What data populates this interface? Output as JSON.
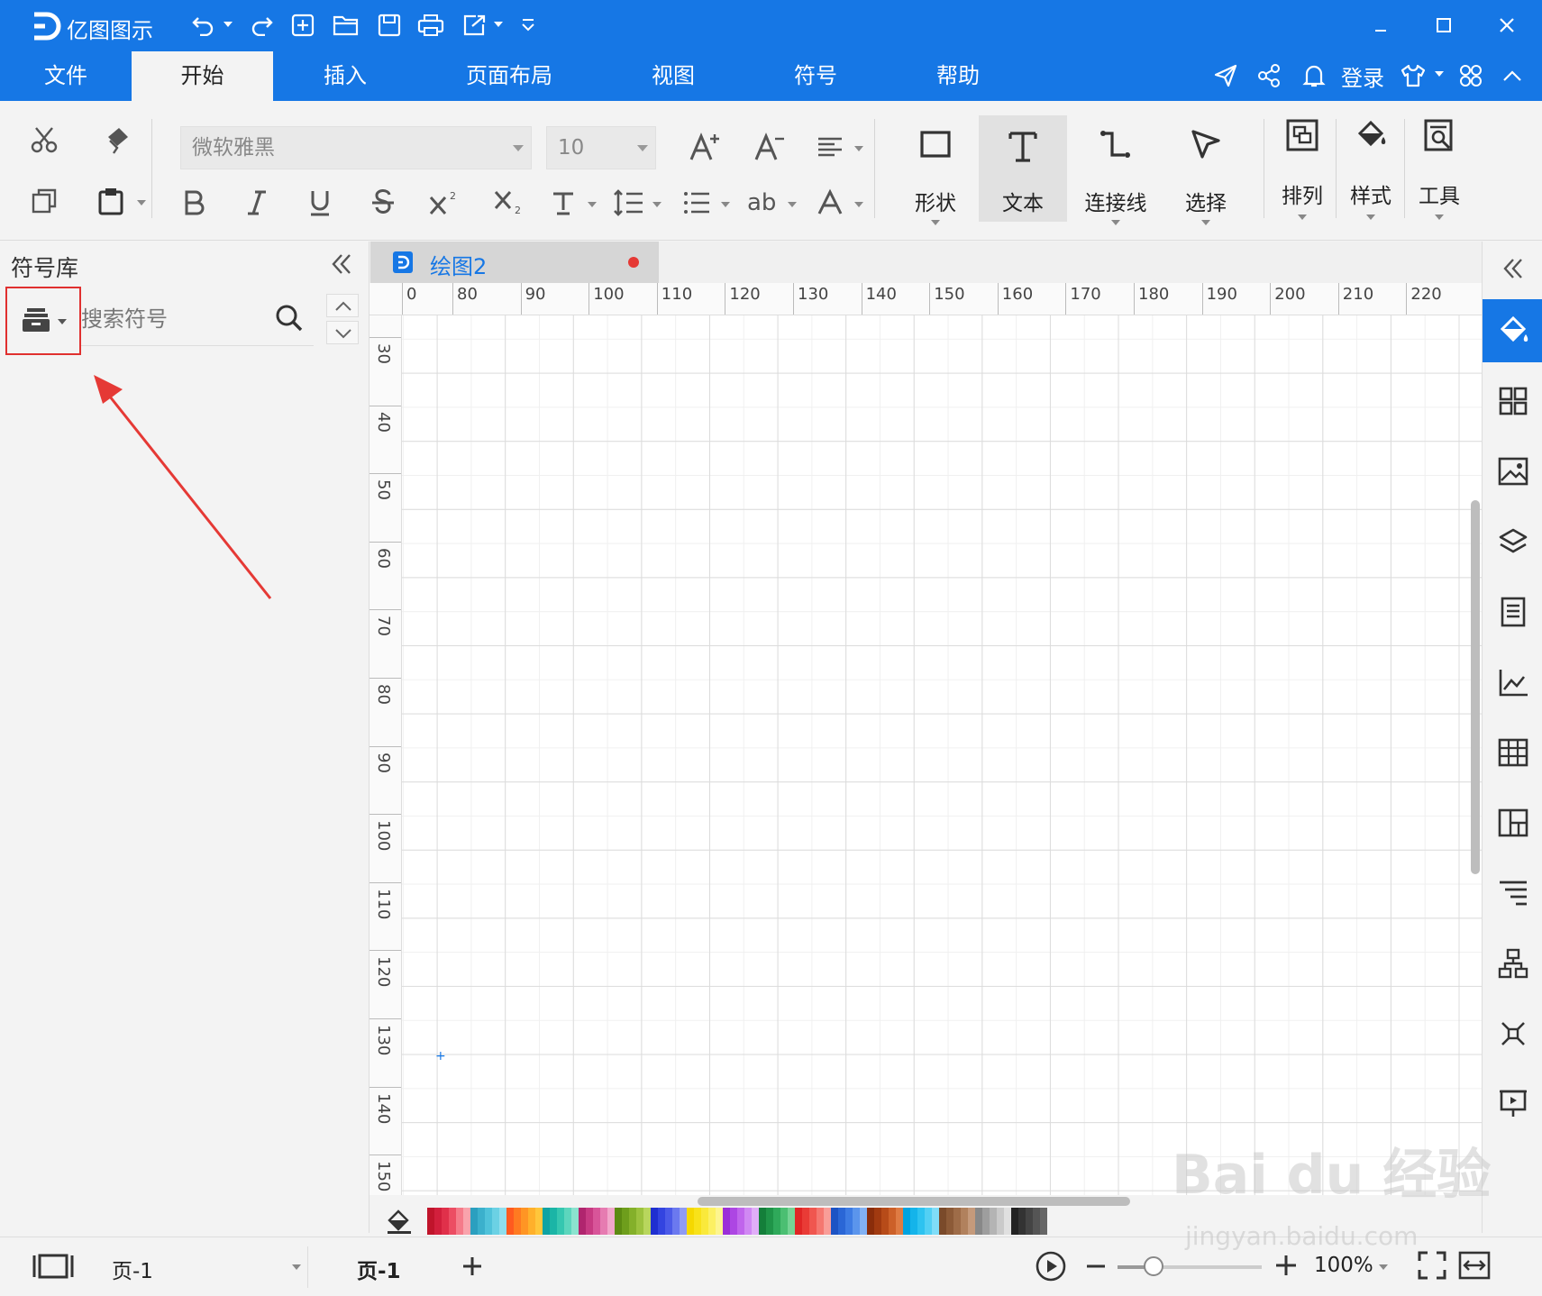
{
  "app": {
    "title": "亿图图示"
  },
  "menu": {
    "items": [
      "文件",
      "开始",
      "插入",
      "页面布局",
      "视图",
      "符号",
      "帮助"
    ],
    "active": "开始",
    "login_label": "登录"
  },
  "ribbon": {
    "font_name": "微软雅黑",
    "font_size": "10",
    "big_buttons": [
      "形状",
      "文本",
      "连接线",
      "选择",
      "排列",
      "样式",
      "工具"
    ]
  },
  "left_panel": {
    "title": "符号库",
    "search_placeholder": "搜索符号"
  },
  "document": {
    "tab_name": "绘图2"
  },
  "ruler": {
    "h_labels": [
      "0",
      "80",
      "90",
      "100",
      "110",
      "120",
      "130",
      "140",
      "150",
      "160",
      "170",
      "180",
      "190",
      "200",
      "210",
      "220"
    ],
    "v_labels": [
      "30",
      "40",
      "50",
      "60",
      "70",
      "80",
      "90",
      "100",
      "110",
      "120",
      "130",
      "140",
      "150"
    ]
  },
  "status": {
    "page_select": "页-1",
    "page_tab": "页-1",
    "zoom": "100%",
    "zoom_fraction": 0.25
  },
  "colors": {
    "accent": "#1677e5",
    "highlight_border": "#e0302f",
    "palette": [
      "#c0142b",
      "#d21f3c",
      "#e0304a",
      "#ec4d63",
      "#f57b8a",
      "#f9a3ac",
      "#2b9fbf",
      "#3bb0cc",
      "#4fc2da",
      "#6bd1e4",
      "#8fdeed",
      "#ff5a1f",
      "#ff7a21",
      "#ff9524",
      "#ffb02b",
      "#ffc63b",
      "#0fa3a3",
      "#1bb5a6",
      "#35c7b0",
      "#5cd6bd",
      "#8be3cf",
      "#b0256e",
      "#c73a82",
      "#d85599",
      "#e67bb1",
      "#f2a6cb",
      "#5c8a12",
      "#6e9e1c",
      "#84b02a",
      "#9cc23e",
      "#b8d65d",
      "#1f2fd0",
      "#3344e0",
      "#4b5ae8",
      "#6b79ef",
      "#8f9bf4",
      "#f5d800",
      "#f8e21a",
      "#fae93b",
      "#fcf063",
      "#fdf58f",
      "#9b2fd8",
      "#ad46e3",
      "#c064ec",
      "#d088f3",
      "#e0aef8",
      "#147f3a",
      "#1f9448",
      "#2fa95a",
      "#4bbf72",
      "#75d394",
      "#e02525",
      "#e93b36",
      "#f0564f",
      "#f57770",
      "#f99d98",
      "#1c53c4",
      "#2a66d6",
      "#3d7be3",
      "#5b95ec",
      "#82b1f3",
      "#8a2d0a",
      "#a13a10",
      "#b74b19",
      "#cc6028",
      "#de7b43",
      "#00a3e0",
      "#14b4ea",
      "#2dc3f0",
      "#52d0f4",
      "#80ddf8",
      "#7a4a2a",
      "#8c5a37",
      "#9e6c48",
      "#b1815d",
      "#c59a7b",
      "#888888",
      "#9e9e9e",
      "#b4b4b4",
      "#cacaca",
      "#e0e0e0",
      "#222222",
      "#333333",
      "#444444",
      "#555555",
      "#666666"
    ]
  },
  "icons": {
    "title_bar": [
      "logo-icon",
      "undo-icon",
      "redo-icon",
      "new-icon",
      "open-icon",
      "save-icon",
      "print-icon",
      "export-icon",
      "customize-icon",
      "minimize-icon",
      "maximize-icon",
      "close-icon"
    ],
    "right_sidebar": [
      "fill-icon",
      "symbols-icon",
      "image-icon",
      "layers-icon",
      "page-icon",
      "chart-icon",
      "table-icon",
      "layout-icon",
      "format-icon",
      "org-chart-icon",
      "mindmap-icon",
      "presentation-icon"
    ]
  },
  "watermark": {
    "main": "Bai du 经验",
    "sub": "jingyan.baidu.com"
  }
}
